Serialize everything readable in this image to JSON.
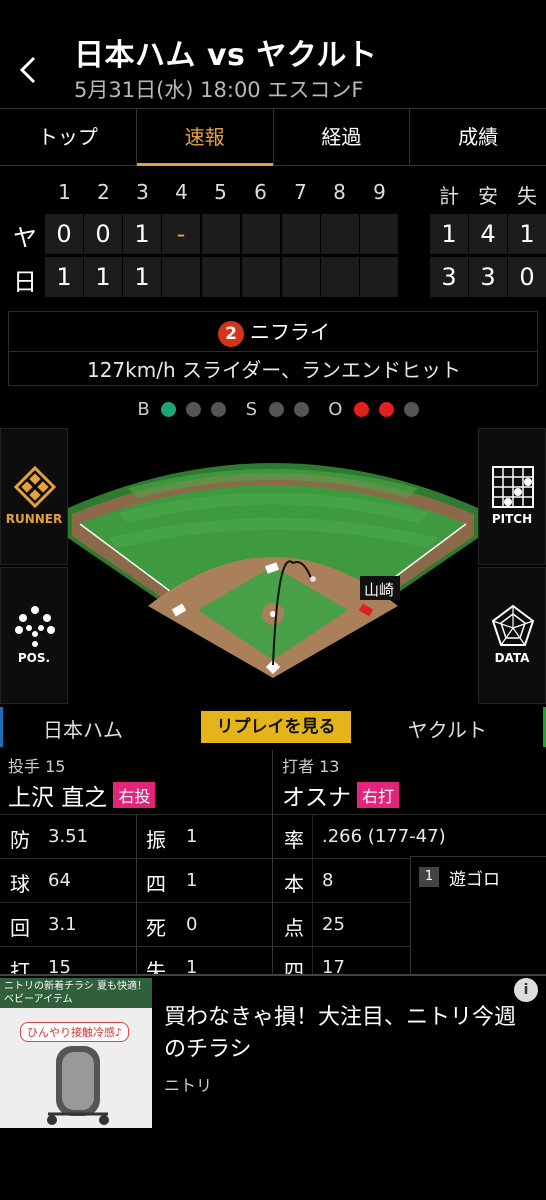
{
  "header": {
    "title": "日本ハム vs ヤクルト",
    "subtitle": "5月31日(水) 18:00 エスコンF"
  },
  "tabs": [
    {
      "label": "トップ",
      "active": false
    },
    {
      "label": "速報",
      "active": true
    },
    {
      "label": "経過",
      "active": false
    },
    {
      "label": "成績",
      "active": false
    }
  ],
  "scoreboard": {
    "innings": [
      "1",
      "2",
      "3",
      "4",
      "5",
      "6",
      "7",
      "8",
      "9"
    ],
    "totals_headers": [
      "計",
      "安",
      "失"
    ],
    "rows": [
      {
        "team": "ヤ",
        "scores": [
          "0",
          "0",
          "1",
          "-",
          "",
          "",
          "",
          "",
          ""
        ],
        "totals": [
          "1",
          "4",
          "1"
        ]
      },
      {
        "team": "日",
        "scores": [
          "1",
          "1",
          "1",
          "",
          "",
          "",
          "",
          "",
          ""
        ],
        "totals": [
          "3",
          "3",
          "0"
        ]
      }
    ]
  },
  "play": {
    "outs": "2",
    "result": "ニフライ",
    "detail": "127km/h スライダー、ランエンドヒット"
  },
  "count": {
    "b_label": "B",
    "balls": 1,
    "s_label": "S",
    "strikes": 0,
    "o_label": "O",
    "outs": 2
  },
  "field": {
    "runner_label": "山崎",
    "buttons": {
      "runner": "RUNNER",
      "pos": "POS.",
      "pitch": "PITCH",
      "data": "DATA"
    }
  },
  "team_bar": {
    "home": "日本ハム",
    "replay": "リプレイを見る",
    "away": "ヤクルト"
  },
  "pitcher": {
    "role": "投手 15",
    "name": "上沢 直之",
    "hand": "右投",
    "stats": [
      {
        "label": "防",
        "value": "3.51"
      },
      {
        "label": "振",
        "value": "1"
      },
      {
        "label": "球",
        "value": "64"
      },
      {
        "label": "四",
        "value": "1"
      },
      {
        "label": "回",
        "value": "3.1"
      },
      {
        "label": "死",
        "value": "0"
      },
      {
        "label": "打",
        "value": "15"
      },
      {
        "label": "失",
        "value": "1"
      }
    ]
  },
  "batter": {
    "role": "打者 13",
    "name": "オスナ",
    "hand": "右打",
    "stats": [
      {
        "label": "率",
        "value": ".266 (177-47)"
      },
      {
        "label": "本",
        "value": "8"
      },
      {
        "label": "点",
        "value": "25"
      },
      {
        "label": "四",
        "value": "17"
      }
    ],
    "at_bats": [
      {
        "num": "1",
        "result": "遊ゴロ"
      }
    ]
  },
  "ad": {
    "image_header": "ニトリの新着チラシ 夏も快適！ベビーアイテム",
    "image_pill": "ひんやり接触冷感♪",
    "title": "買わなきゃ損！大注目、ニトリ今週のチラシ",
    "source": "ニトリ",
    "info": "i"
  },
  "colors": {
    "accent": "#e5a23a",
    "hand_badge": "#e2247b",
    "replay": "#e5b41a",
    "out_dot": "#e01f1f",
    "ball_dot": "#1ea37a"
  }
}
